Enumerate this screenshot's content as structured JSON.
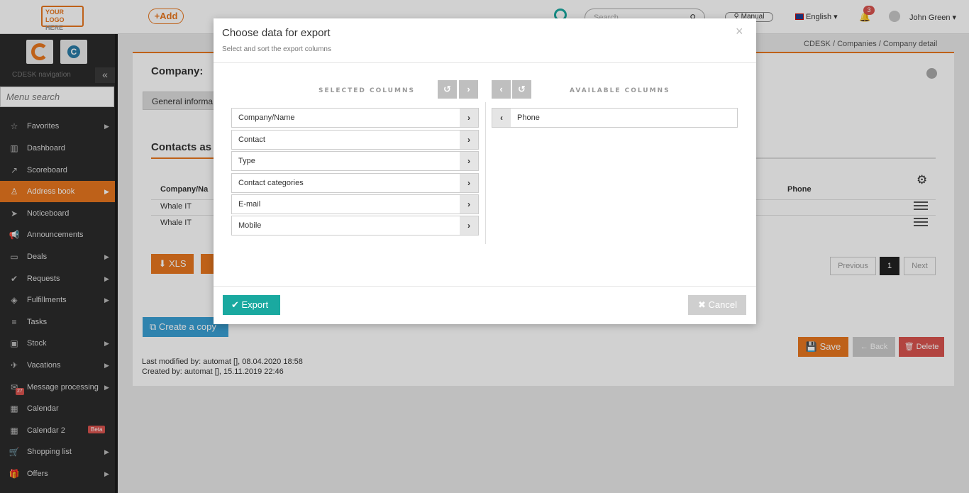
{
  "header": {
    "logo_line1": "YOUR LOGO",
    "logo_line2": "HERE",
    "add_label": "+Add",
    "search_placeholder": "Search",
    "manual_label": "Manual",
    "language": "English",
    "notifications_count": "3",
    "user_name": "John Green"
  },
  "sidebar": {
    "nav_caption": "CDESK navigation",
    "collapse_glyph": "«",
    "menu_search_placeholder": "Menu search",
    "items": [
      {
        "label": "Favorites",
        "icon": "☆",
        "arrow": "▶"
      },
      {
        "label": "Dashboard",
        "icon": "▥",
        "arrow": ""
      },
      {
        "label": "Scoreboard",
        "icon": "↗",
        "arrow": ""
      },
      {
        "label": "Address book",
        "icon": "♙",
        "arrow": "▶"
      },
      {
        "label": "Noticeboard",
        "icon": "➤",
        "arrow": ""
      },
      {
        "label": "Announcements",
        "icon": "📢",
        "arrow": ""
      },
      {
        "label": "Deals",
        "icon": "▭",
        "arrow": "▶"
      },
      {
        "label": "Requests",
        "icon": "✔",
        "arrow": "▶"
      },
      {
        "label": "Fulfillments",
        "icon": "◈",
        "arrow": "▶"
      },
      {
        "label": "Tasks",
        "icon": "≡",
        "arrow": ""
      },
      {
        "label": "Stock",
        "icon": "▣",
        "arrow": "▶"
      },
      {
        "label": "Vacations",
        "icon": "✈",
        "arrow": "▶"
      },
      {
        "label": "Message processing",
        "icon": "✉",
        "arrow": "▶",
        "badge": "27"
      },
      {
        "label": "Calendar",
        "icon": "▦",
        "arrow": ""
      },
      {
        "label": "Calendar 2",
        "icon": "▦",
        "arrow": "",
        "badge": "Beta"
      },
      {
        "label": "Shopping list",
        "icon": "🛒",
        "arrow": "▶"
      },
      {
        "label": "Offers",
        "icon": "🎁",
        "arrow": "▶"
      }
    ]
  },
  "breadcrumb": {
    "text": "CDESK  /  Companies  /  Company detail"
  },
  "content": {
    "company_title": "Company:",
    "general_tab": "General informa",
    "contacts_title": "Contacts as",
    "col_company": "Company/Na",
    "col_phone": "Phone",
    "rows": [
      "Whale IT",
      "Whale IT"
    ],
    "xls_label": "⬇ XLS",
    "pagination": {
      "previous": "Previous",
      "current": "1",
      "next": "Next"
    },
    "create_copy_label": "⧉ Create a copy",
    "save_label": "💾 Save",
    "back_label": "← Back",
    "delete_label": "🗑 Delete",
    "last_modified": "Last modified by: automat  [], 08.04.2020 18:58",
    "created_by": "Created by: automat  [], 15.11.2019 22:46"
  },
  "modal": {
    "title": "Choose data for export",
    "subtitle": "Select and sort the export columns",
    "close_glyph": "×",
    "selected_title": "SELECTED COLUMNS",
    "available_title": "AVAILABLE COLUMNS",
    "selected_columns": [
      "Company/Name",
      "Contact",
      "Type",
      "Contact categories",
      "E-mail",
      "Mobile"
    ],
    "available_columns": [
      "Phone"
    ],
    "export_label": "✔ Export",
    "cancel_label": "✖ Cancel"
  },
  "colors": {
    "accent": "#e8771f",
    "teal": "#1aa9a0",
    "danger": "#d9534f",
    "sidebar_bg": "#2b2b2b"
  }
}
